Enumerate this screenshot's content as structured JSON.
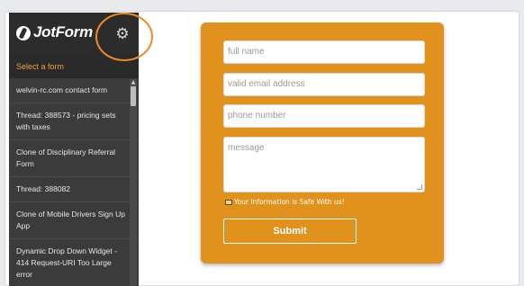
{
  "sidebar": {
    "logo_text": "JotForm",
    "gear_icon": "gear-icon",
    "select_label": "Select a form",
    "items": [
      {
        "label": "welvin-rc.com contact form"
      },
      {
        "label": "Thread: 388573 - pricing sets with taxes"
      },
      {
        "label": "Clone of Disciplinary Referral Form"
      },
      {
        "label": "Thread: 388082"
      },
      {
        "label": "Clone of Mobile Drivers Sign Up App"
      },
      {
        "label": "Dynamic Drop Down Widget - 414 Request-URI Too Large error"
      }
    ]
  },
  "form": {
    "full_name_placeholder": "full name",
    "email_placeholder": "valid email address",
    "phone_placeholder": "phone number",
    "message_placeholder": "message",
    "safe_note": "Your Information is Safe With us!",
    "submit_label": "Submit"
  },
  "colors": {
    "accent": "#e0921d",
    "highlight_ring": "#ee8a27",
    "sidebar_bg": "#3b3b3b"
  }
}
